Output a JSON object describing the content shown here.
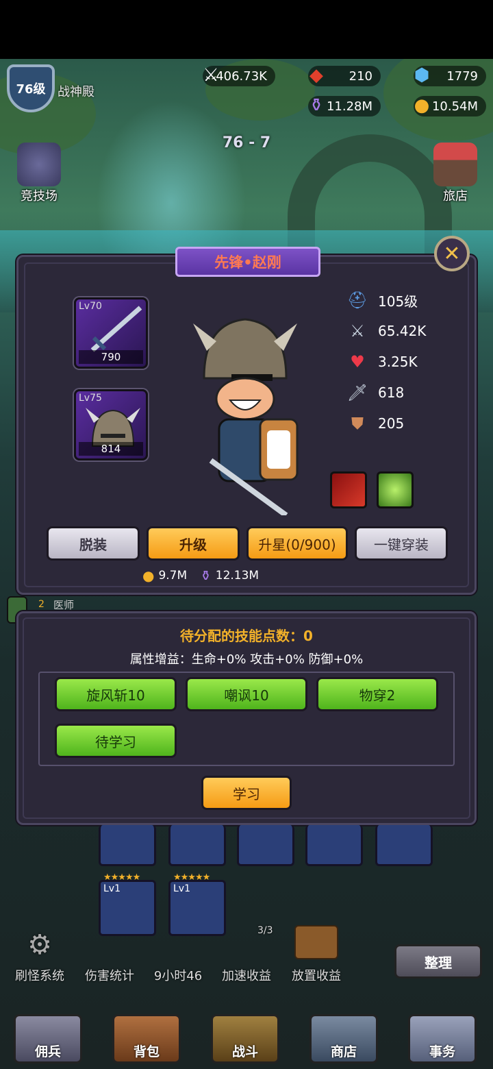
{
  "header": {
    "level_badge": "76级",
    "hall_label": "战神殿",
    "resources": {
      "power": {
        "value": "406.73K",
        "icon": "crossed-swords-icon"
      },
      "ruby": {
        "value": "210",
        "icon": "red-gem-icon"
      },
      "crystal": {
        "value": "1779",
        "icon": "blue-crystal-icon"
      },
      "potion": {
        "value": "11.28M",
        "icon": "potion-icon"
      },
      "gold": {
        "value": "10.54M",
        "icon": "gold-coin-icon"
      }
    },
    "stage": "76 - 7"
  },
  "side": {
    "arena_label": "竞技场",
    "inn_label": "旅店"
  },
  "hero_panel": {
    "title": "先锋•赵刚",
    "equipment": [
      {
        "level": "Lv70",
        "value": "790",
        "icon": "sword-icon"
      },
      {
        "level": "Lv75",
        "value": "814",
        "icon": "horned-helmet-icon"
      }
    ],
    "stats": [
      {
        "icon": "winged-helmet-icon",
        "value": "105级"
      },
      {
        "icon": "crossed-swords-icon",
        "value": "65.42K"
      },
      {
        "icon": "heart-icon",
        "value": "3.25K"
      },
      {
        "icon": "sword-icon",
        "value": "618"
      },
      {
        "icon": "shield-icon",
        "value": "205"
      }
    ],
    "buttons": {
      "unequip": "脱装",
      "upgrade": "升级",
      "star_up": "升星(0/900)",
      "equip_all": "一键穿装"
    },
    "costs": {
      "gold": "9.7M",
      "potion": "12.13M"
    }
  },
  "skill_panel": {
    "points_label": "待分配的技能点数：0",
    "bonus_label": "属性增益：生命+0% 攻击+0% 防御+0%",
    "skills": [
      "旋风斩10",
      "嘲讽10",
      "物穿2",
      "待学习"
    ],
    "learn_button": "学习"
  },
  "roster": {
    "doctor_label": "医师",
    "doctor_count": "2",
    "bottom_cards": [
      {
        "level": "Lv1",
        "stars": "★★★★★"
      },
      {
        "level": "Lv1",
        "stars": "★★★★★"
      }
    ]
  },
  "tools": {
    "monster_system": "刷怪系统",
    "damage_stats": "伤害统计",
    "timer": "9小时46",
    "speedup": "加速收益",
    "speedup_count": "3/3",
    "idle_income": "放置收益",
    "sort_button": "整理"
  },
  "nav": {
    "mercenary": "佣兵",
    "bag": "背包",
    "battle": "战斗",
    "shop": "商店",
    "affairs": "事务"
  },
  "colors": {
    "panel_bg": "#2c2839",
    "title_purple": "#6a40b4",
    "title_text": "#ff7a52",
    "gold_button": "#f59b14",
    "green_button": "#4fb41c",
    "gray_button": "#b9b5c4"
  }
}
